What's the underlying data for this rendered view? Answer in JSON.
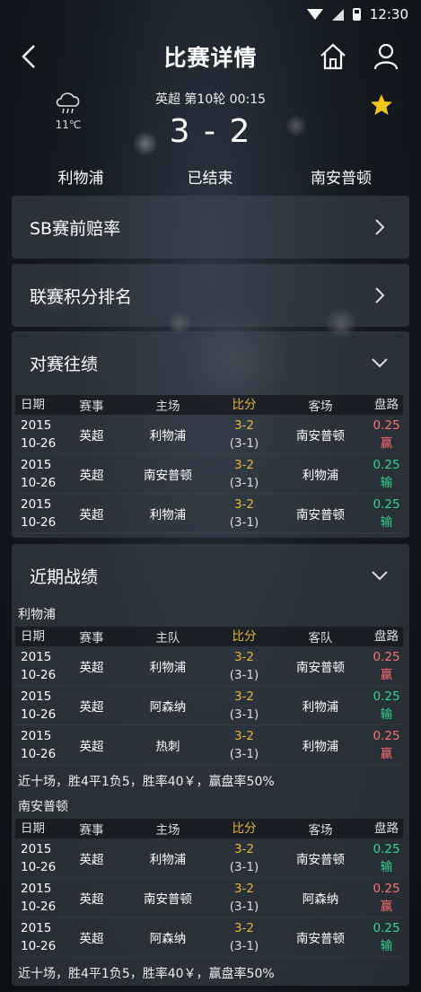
{
  "status_bar": {
    "time": "12:30"
  },
  "header": {
    "title": "比赛详情"
  },
  "match": {
    "temperature": "11℃",
    "meta": "英超 第10轮 00:15",
    "score": "3 - 2",
    "home_team": "利物浦",
    "status": "已结束",
    "away_team": "南安普顿"
  },
  "panels": {
    "odds": "SB赛前赔率",
    "standings": "联赛积分排名",
    "h2h": "对赛往绩",
    "recent": "近期战绩"
  },
  "colors": {
    "score": "#e8b43a",
    "win": "#ff6f6f",
    "lose": "#34d28a",
    "star": "#f5c518"
  },
  "h2h": {
    "headers": [
      "日期",
      "赛事",
      "主场",
      "比分",
      "客场",
      "盘路"
    ],
    "rows": [
      {
        "date1": "2015",
        "date2": "10-26",
        "comp": "英超",
        "home": "利物浦",
        "score": "3-2",
        "half": "(3-1)",
        "away": "南安普顿",
        "line": "0.25",
        "result": "赢",
        "outcome": "win"
      },
      {
        "date1": "2015",
        "date2": "10-26",
        "comp": "英超",
        "home": "南安普顿",
        "score": "3-2",
        "half": "(3-1)",
        "away": "利物浦",
        "line": "0.25",
        "result": "输",
        "outcome": "lose"
      },
      {
        "date1": "2015",
        "date2": "10-26",
        "comp": "英超",
        "home": "利物浦",
        "score": "3-2",
        "half": "(3-1)",
        "away": "南安普顿",
        "line": "0.25",
        "result": "输",
        "outcome": "lose"
      }
    ]
  },
  "recent": {
    "team1": {
      "name": "利物浦",
      "headers": [
        "日期",
        "赛事",
        "主队",
        "比分",
        "客队",
        "盘路"
      ],
      "rows": [
        {
          "date1": "2015",
          "date2": "10-26",
          "comp": "英超",
          "home": "利物浦",
          "score": "3-2",
          "half": "(3-1)",
          "away": "南安普顿",
          "line": "0.25",
          "result": "赢",
          "outcome": "win"
        },
        {
          "date1": "2015",
          "date2": "10-26",
          "comp": "英超",
          "home": "阿森纳",
          "score": "3-2",
          "half": "(3-1)",
          "away": "利物浦",
          "line": "0.25",
          "result": "输",
          "outcome": "lose"
        },
        {
          "date1": "2015",
          "date2": "10-26",
          "comp": "英超",
          "home": "热刺",
          "score": "3-2",
          "half": "(3-1)",
          "away": "利物浦",
          "line": "0.25",
          "result": "赢",
          "outcome": "win"
        }
      ],
      "summary": "近十场，胜4平1负5，胜率40￥，赢盘率50%"
    },
    "team2": {
      "name": "南安普顿",
      "headers": [
        "日期",
        "赛事",
        "主场",
        "比分",
        "客场",
        "盘路"
      ],
      "rows": [
        {
          "date1": "2015",
          "date2": "10-26",
          "comp": "英超",
          "home": "利物浦",
          "score": "3-2",
          "half": "(3-1)",
          "away": "南安普顿",
          "line": "0.25",
          "result": "输",
          "outcome": "lose"
        },
        {
          "date1": "2015",
          "date2": "10-26",
          "comp": "英超",
          "home": "南安普顿",
          "score": "3-2",
          "half": "(3-1)",
          "away": "阿森纳",
          "line": "0.25",
          "result": "赢",
          "outcome": "win"
        },
        {
          "date1": "2015",
          "date2": "10-26",
          "comp": "英超",
          "home": "阿森纳",
          "score": "3-2",
          "half": "(3-1)",
          "away": "南安普顿",
          "line": "0.25",
          "result": "输",
          "outcome": "lose"
        }
      ],
      "summary": "近十场，胜4平1负5，胜率40￥，赢盘率50%"
    }
  }
}
